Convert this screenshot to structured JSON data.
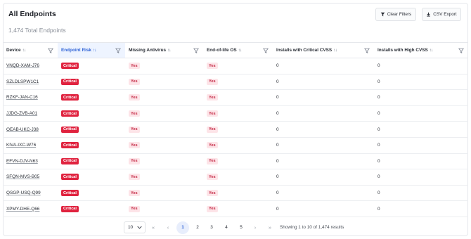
{
  "header": {
    "title": "All Endpoints",
    "subtitle": "1,474 Total Endpoints",
    "clear_filters": "Clear Filters",
    "csv_export": "CSV Export"
  },
  "columns": [
    {
      "label": "Device",
      "sort": "↑↓"
    },
    {
      "label": "Endpoint Risk",
      "sort": "↑↓"
    },
    {
      "label": "Missing Antivirus",
      "sort": "↑↓"
    },
    {
      "label": "End-of-life OS",
      "sort": "↑↓"
    },
    {
      "label": "Installs with Critical CVSS",
      "sort": "↑↓"
    },
    {
      "label": "Installs with High CVSS",
      "sort": "↑↓"
    }
  ],
  "rows": [
    {
      "device": "VNQD-XAM-J76",
      "risk": "Critical",
      "antivirus": "Yes",
      "eol": "Yes",
      "critical": "0",
      "high": "0"
    },
    {
      "device": "SZLDLSPW1C1",
      "risk": "Critical",
      "antivirus": "Yes",
      "eol": "Yes",
      "critical": "0",
      "high": "0"
    },
    {
      "device": "RZKF-JAN-C16",
      "risk": "Critical",
      "antivirus": "Yes",
      "eol": "Yes",
      "critical": "0",
      "high": "0"
    },
    {
      "device": "JJDG-ZVB-A01",
      "risk": "Critical",
      "antivirus": "Yes",
      "eol": "Yes",
      "critical": "0",
      "high": "0"
    },
    {
      "device": "OEAB-UKC-J38",
      "risk": "Critical",
      "antivirus": "Yes",
      "eol": "Yes",
      "critical": "0",
      "high": "0"
    },
    {
      "device": "KIVA-IXC-W76",
      "risk": "Critical",
      "antivirus": "Yes",
      "eol": "Yes",
      "critical": "0",
      "high": "0"
    },
    {
      "device": "EFVN-DJV-N63",
      "risk": "Critical",
      "antivirus": "Yes",
      "eol": "Yes",
      "critical": "0",
      "high": "0"
    },
    {
      "device": "SFQN-MVS-B05",
      "risk": "Critical",
      "antivirus": "Yes",
      "eol": "Yes",
      "critical": "0",
      "high": "0"
    },
    {
      "device": "QSGP-USQ-Q99",
      "risk": "Critical",
      "antivirus": "Yes",
      "eol": "Yes",
      "critical": "0",
      "high": "0"
    },
    {
      "device": "XPMY-DHE-Q66",
      "risk": "Critical",
      "antivirus": "Yes",
      "eol": "Yes",
      "critical": "0",
      "high": "0"
    }
  ],
  "pagination": {
    "page_size": "10",
    "first": "«",
    "prev": "‹",
    "next": "›",
    "last": "»",
    "pages": [
      "1",
      "2",
      "3",
      "4",
      "5"
    ],
    "current_page": "1",
    "showing": "Showing 1 to 10 of 1,474 results"
  },
  "colors": {
    "accent": "#2f63d6",
    "critical": "#e0233f",
    "yes_bg": "#fde4e8"
  }
}
